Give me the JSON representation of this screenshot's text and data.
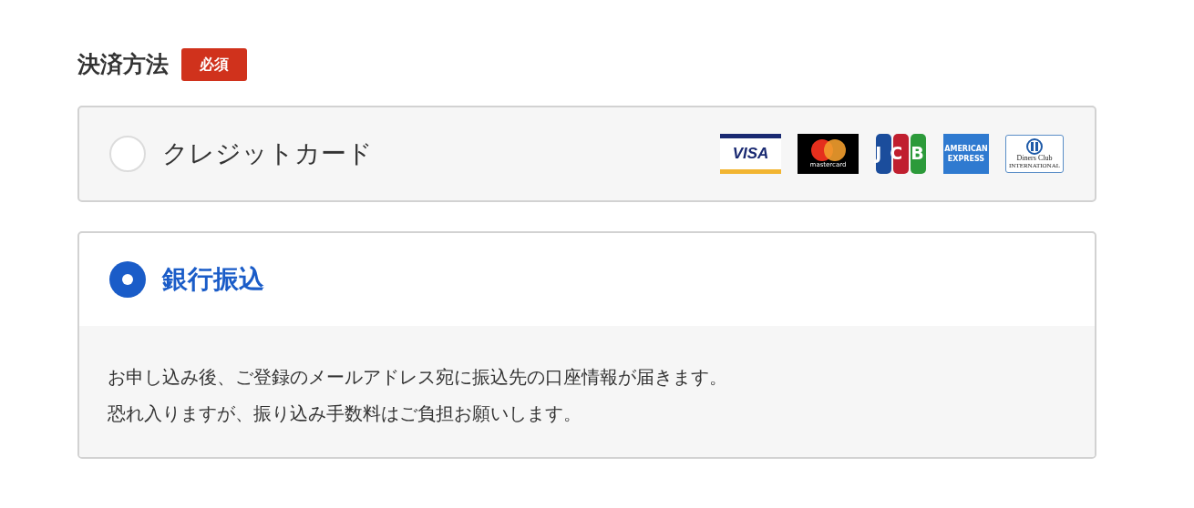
{
  "section": {
    "title": "決済方法",
    "badge": "必須"
  },
  "methods": [
    {
      "label": "クレジットカード",
      "selected": false,
      "logos": [
        {
          "kind": "visa",
          "text": "VISA"
        },
        {
          "kind": "mastercard",
          "text": "mastercard"
        },
        {
          "kind": "jcb",
          "text": "JCB"
        },
        {
          "kind": "amex",
          "text": "AMERICAN EXPRESS"
        },
        {
          "kind": "diners",
          "text": "Diners Club",
          "subtext": "INTERNATIONAL"
        }
      ]
    },
    {
      "label": "銀行振込",
      "selected": true,
      "description": [
        "お申し込み後、ご登録のメールアドレス宛に振込先の口座情報が届きます。",
        "恐れ入りますが、振り込み手数料はご負担お願いします。"
      ]
    }
  ]
}
